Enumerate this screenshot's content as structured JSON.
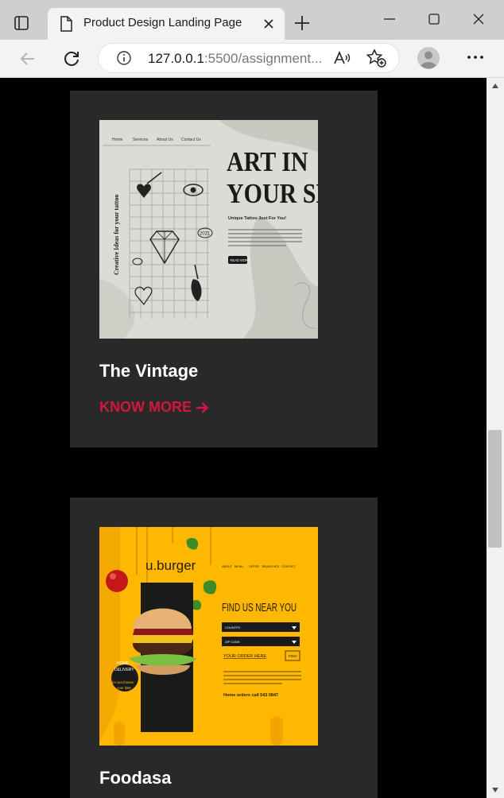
{
  "browser": {
    "tab_title": "Product Design Landing Page",
    "url_host": "127.0.0.1",
    "url_rest": ":5500/assignment..."
  },
  "cards": [
    {
      "title": "The Vintage",
      "link": "KNOW MORE",
      "image": {
        "nav": [
          "Home",
          "Services",
          "About Us",
          "Contact Us"
        ],
        "side_text": "Creative Ideas for your tattoo",
        "headline_1": "ART IN",
        "headline_2": "YOUR SKIN",
        "subhead": "Unique Tattoo Just For You!",
        "button": "READ MORE",
        "year": "2021"
      }
    },
    {
      "title": "Foodasa",
      "image": {
        "brand": "u.burger",
        "nav": [
          "ABOUT",
          "MENU",
          "OFFER",
          "BRANCHES",
          "CONTACT"
        ],
        "headline": "FIND US NEAR YOU",
        "country": "COUNTRY",
        "zip": "ZIP CODE",
        "order": "YOUR ORDER HERE",
        "find": "FIND",
        "badge_1": "HOME",
        "badge_2": "DELIVERY",
        "badge_3": "for purchases",
        "badge_4": "over $50",
        "phone": "Home orders call 543 0847"
      }
    }
  ],
  "colors": {
    "accent": "#d3163f",
    "card_bg": "#292929",
    "burger_bg": "#ffb800"
  }
}
